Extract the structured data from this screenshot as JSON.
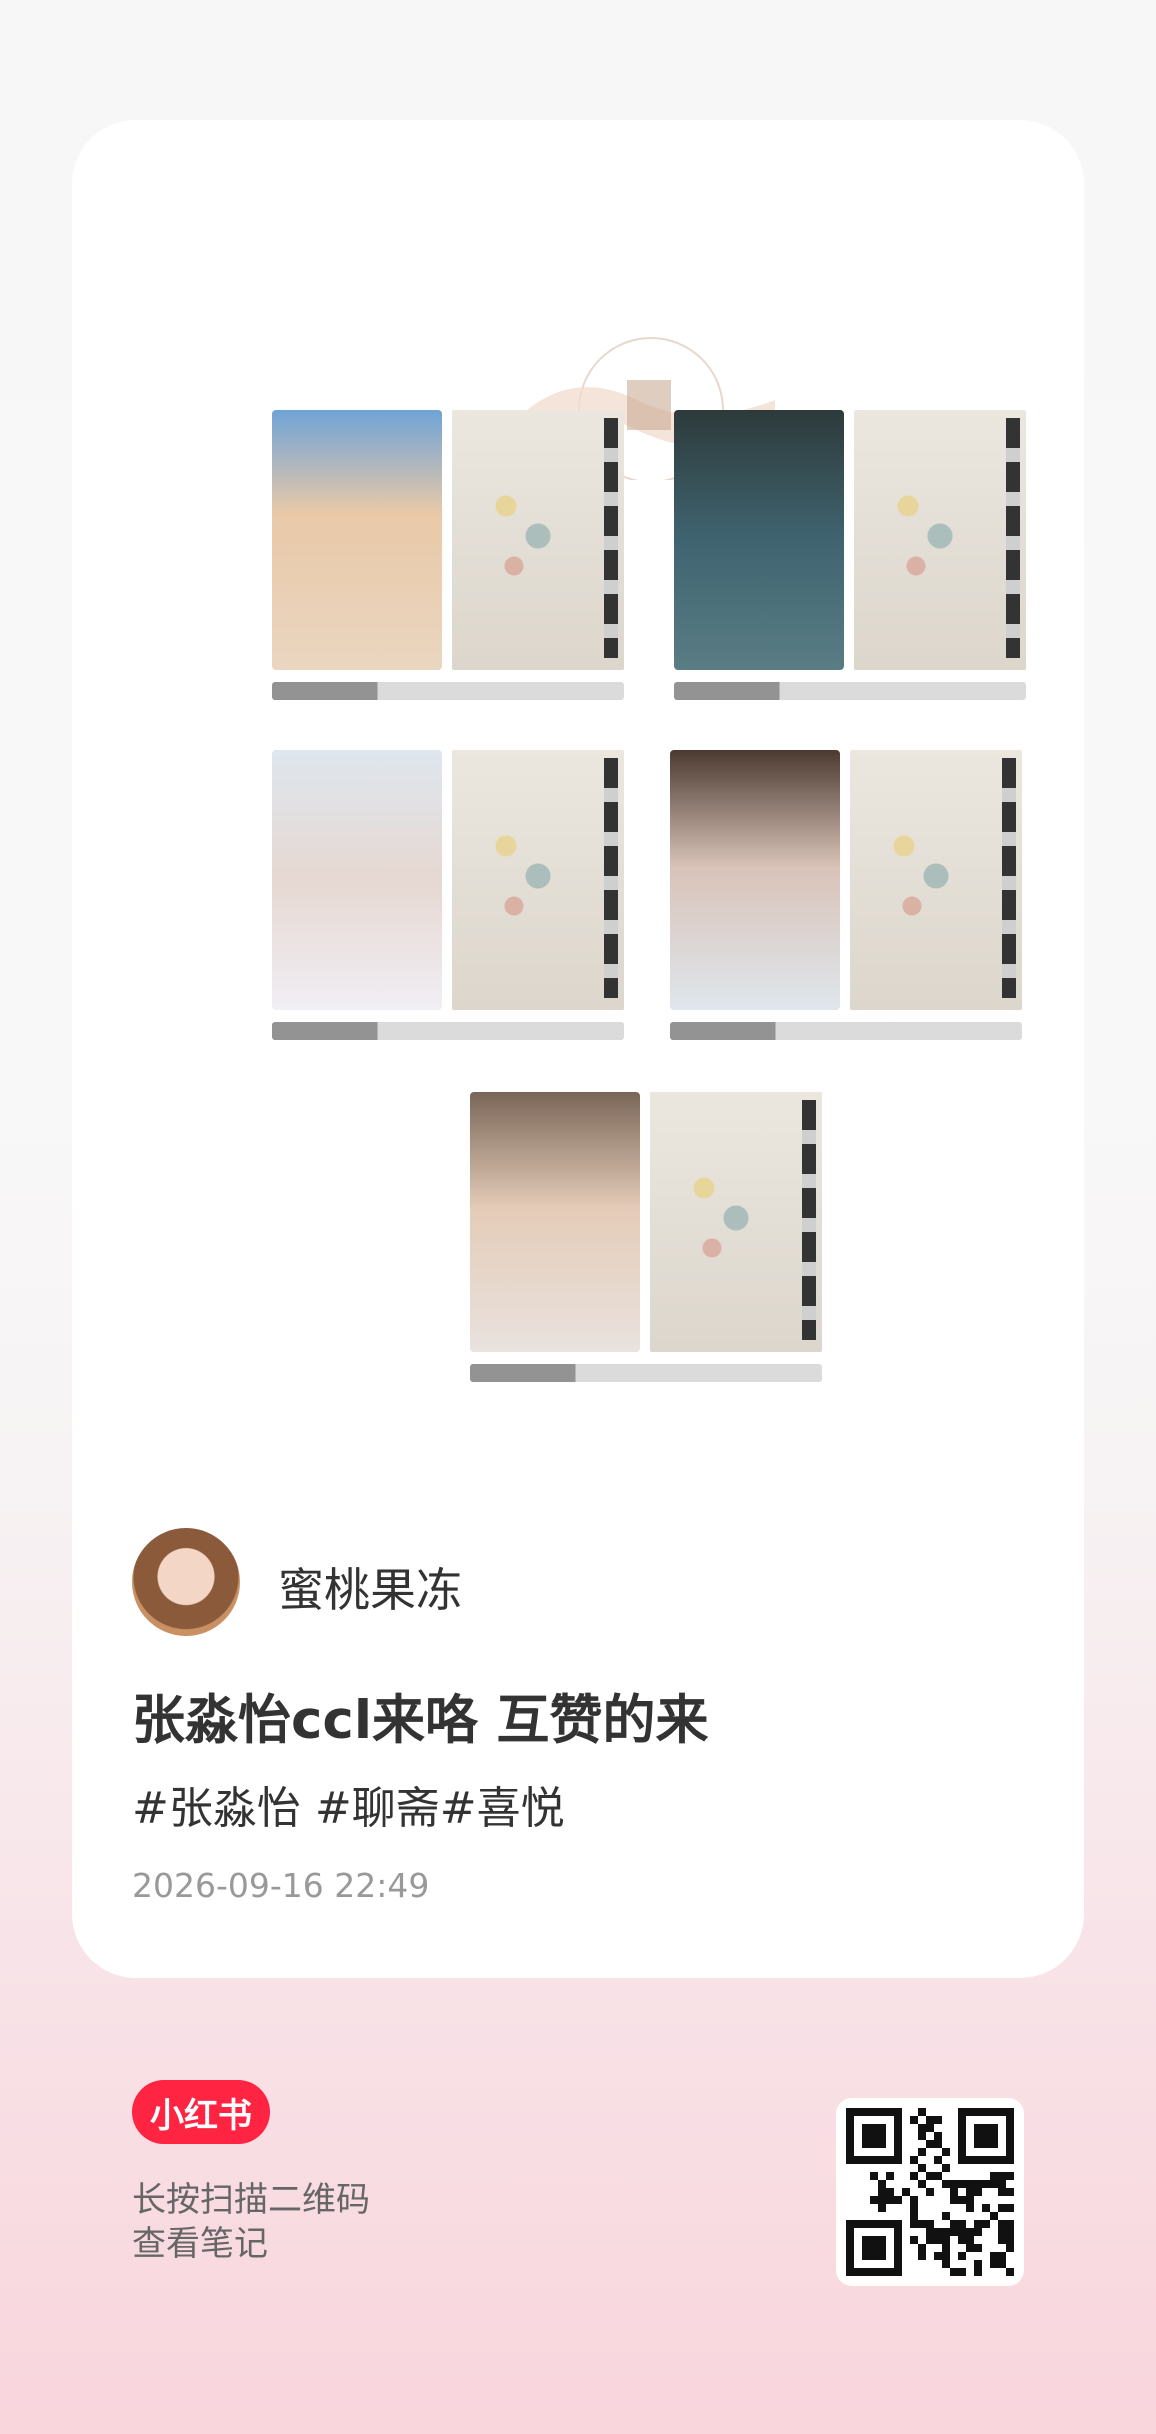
{
  "author": {
    "name": "蜜桃果冻"
  },
  "note": {
    "title": "张淼怡ccl来咯 互赞的来",
    "tags": "#张淼怡 #聊斋#喜悦",
    "timestamp": "2026-09-16 22:49"
  },
  "brand": {
    "logo_text": "小红书"
  },
  "scan": {
    "line1": "长按扫描二维码",
    "line2": "查看笔记"
  },
  "colors": {
    "brand_red": "#ff2442",
    "text_primary": "#333333",
    "text_muted": "#999999"
  }
}
